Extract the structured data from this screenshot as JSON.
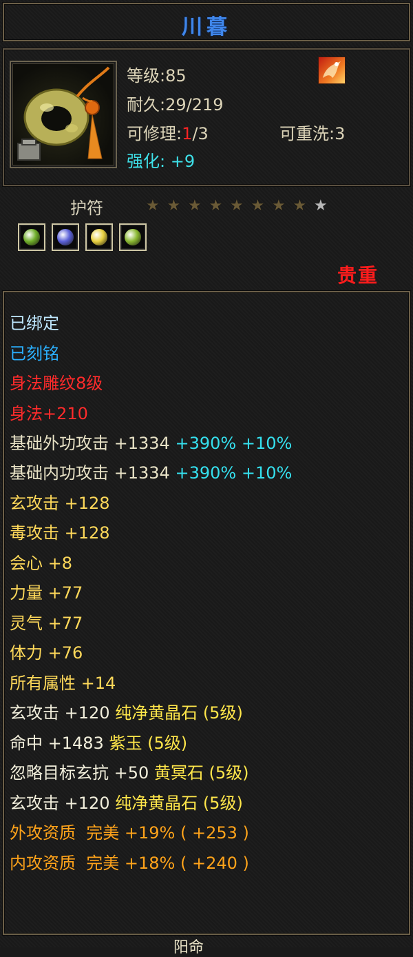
{
  "title": "川暮",
  "header": {
    "level": "等级:85",
    "durability": "耐久:29/219",
    "repair_label": "可修理:",
    "repair_used": "1",
    "repair_total": "/3",
    "rewash": "可重洗:3",
    "enhance_label": "强化:",
    "enhance_value": "+9",
    "icon": "jade-ring-pendant-icon",
    "buff_icon": "dragon-buff-icon"
  },
  "slots": {
    "type": "护符",
    "stars_filled": 8,
    "stars_total": 9,
    "gems": [
      {
        "icon": "green-gem-icon",
        "color": "#6fae2a"
      },
      {
        "icon": "purple-gem-icon",
        "color": "#5a60d8"
      },
      {
        "icon": "yellow-gem-icon",
        "color": "#e8d040"
      },
      {
        "icon": "green-gem-icon",
        "color": "#8ab832"
      }
    ],
    "rarity": "贵重"
  },
  "attributes": {
    "bound": "已绑定",
    "engraved": "已刻铭",
    "carving": "身法雕纹8级",
    "agility": "身法+210",
    "outer_attack": {
      "label": "基础外功攻击 +1334",
      "pct1": "+390%",
      "pct2": "+10%"
    },
    "inner_attack": {
      "label": "基础内功攻击 +1334",
      "pct1": "+390%",
      "pct2": "+10%"
    },
    "xuan_attack": "玄攻击 +128",
    "poison_attack": "毒攻击 +128",
    "crit": "会心 +8",
    "strength": "力量 +77",
    "spirit": "灵气 +77",
    "stamina": "体力 +76",
    "all_attr": "所有属性 +14",
    "gem_lines": [
      {
        "stat": "玄攻击 +120",
        "gem": "纯净黄晶石 (5级)"
      },
      {
        "stat": "命中 +1483",
        "gem": "紫玉 (5级)"
      },
      {
        "stat": "忽略目标玄抗 +50",
        "gem": "黄冥石 (5级)"
      },
      {
        "stat": "玄攻击 +120",
        "gem": "纯净黄晶石 (5级)"
      }
    ],
    "outer_quality": "外攻资质  完美 +19% ( +253 )",
    "inner_quality": "内攻资质  完美 +18% ( +240 )"
  },
  "footer": "阳命"
}
